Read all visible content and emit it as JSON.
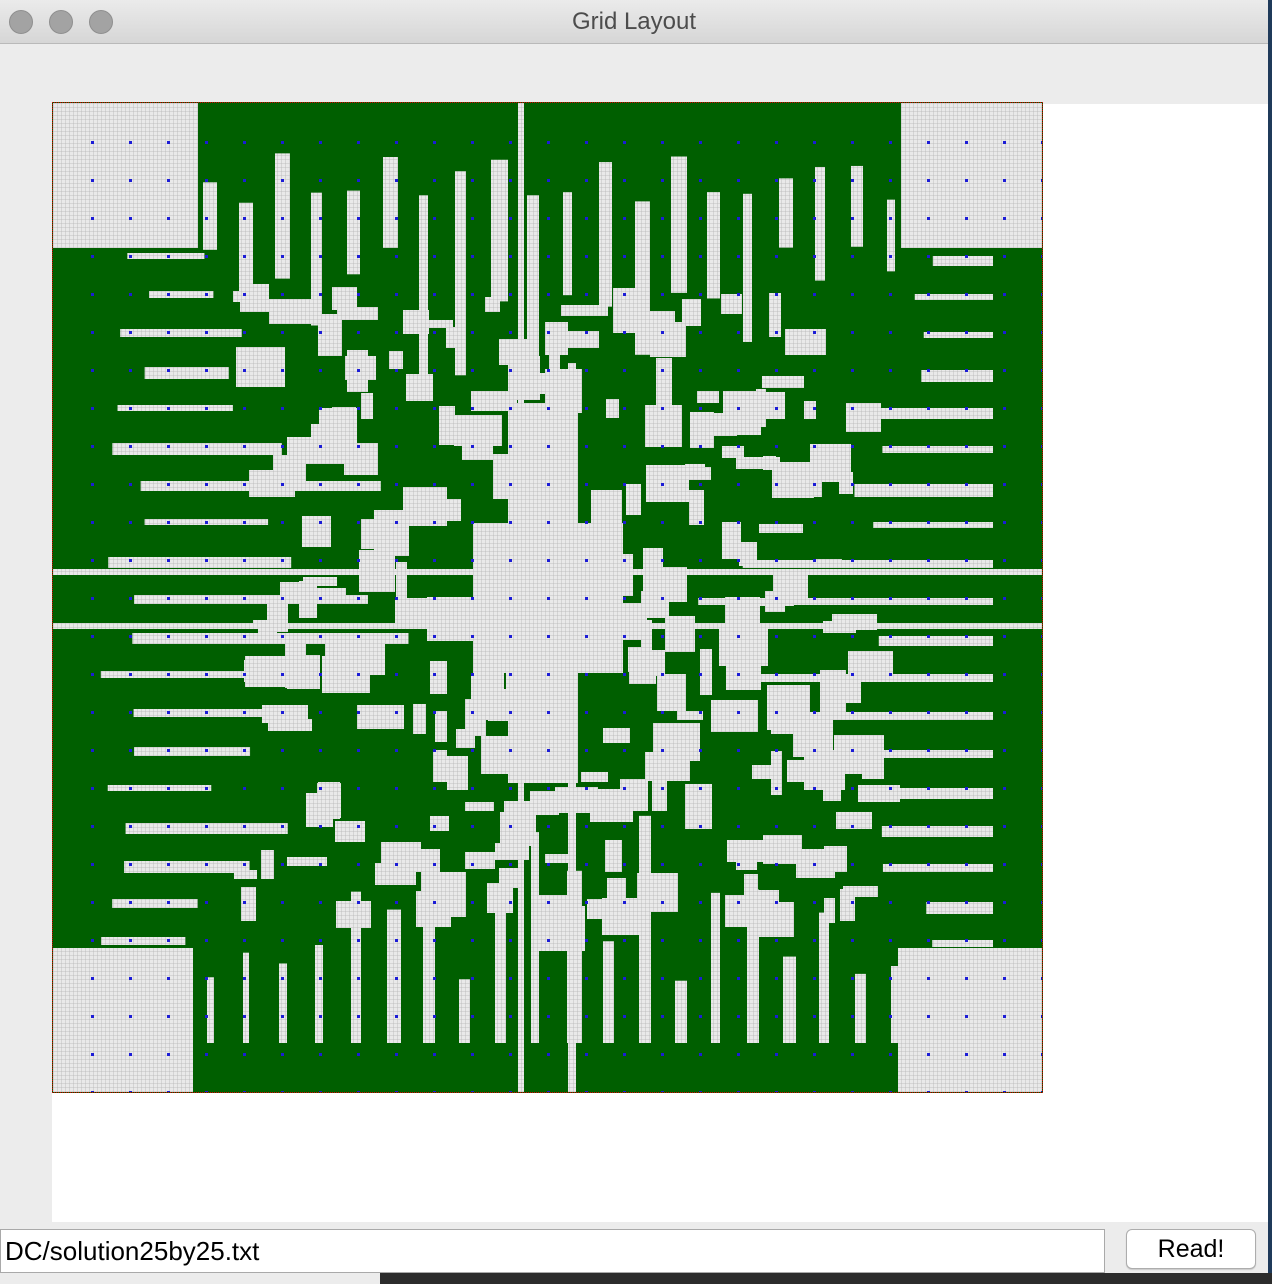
{
  "window": {
    "title": "Grid Layout",
    "traffic_lights": [
      "close",
      "minimize",
      "zoom"
    ]
  },
  "grid": {
    "background_color": "#005f00",
    "cell_color": "#e6e6e6",
    "cell_line_color": "#bdbdbd",
    "pin_color": "#1c1cd6",
    "border_color": "#d40000"
  },
  "footer": {
    "file_path": "DC/solution25by25.txt",
    "read_button_label": "Read!"
  }
}
